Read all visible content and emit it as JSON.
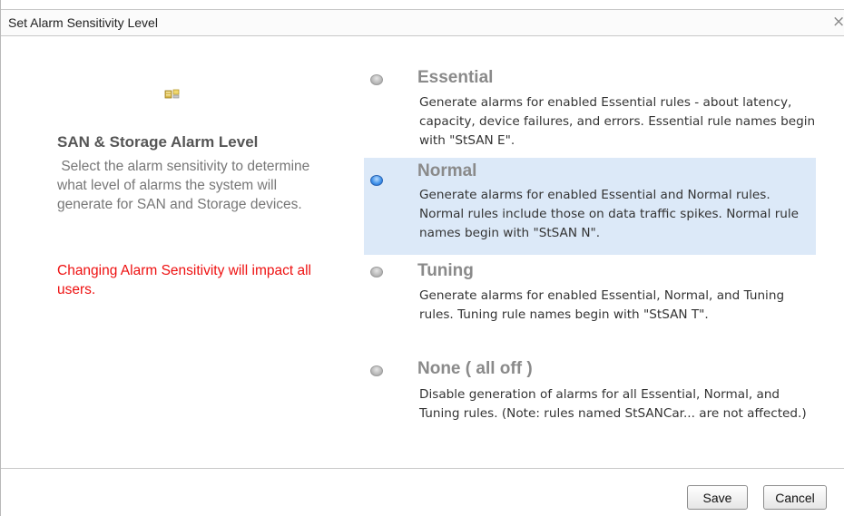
{
  "dialog": {
    "title": "Set Alarm Sensitivity Level",
    "close_glyph": "×"
  },
  "left": {
    "icon": "san-storage-icon",
    "heading": "SAN & Storage Alarm Level",
    "description": " Select the alarm sensitivity to determine what level of alarms the system will generate for SAN and Storage devices.",
    "warning": "Changing Alarm Sensitivity will impact all users."
  },
  "options": [
    {
      "label": "Essential",
      "description": "Generate alarms for enabled Essential rules - about latency, capacity, device failures, and errors. Essential rule names begin with \"StSAN E\".",
      "selected": false
    },
    {
      "label": "Normal",
      "description": "Generate alarms for enabled Essential and Normal rules. Normal rules include those on data traffic spikes. Normal rule names begin with \"StSAN N\".",
      "selected": true
    },
    {
      "label": "Tuning",
      "description": "Generate alarms for enabled Essential, Normal, and Tuning rules. Tuning rule names begin with \"StSAN T\".",
      "selected": false
    },
    {
      "label": "None ( all off )",
      "description": "Disable generation of alarms for all Essential, Normal, and Tuning rules. (Note: rules named StSANCar... are not affected.)",
      "selected": false
    }
  ],
  "footer": {
    "save_label": "Save",
    "cancel_label": "Cancel"
  },
  "colors": {
    "selected_bg": "#dce9f8",
    "warning": "#ee1111",
    "radio_selected": "#3d8fe8"
  }
}
